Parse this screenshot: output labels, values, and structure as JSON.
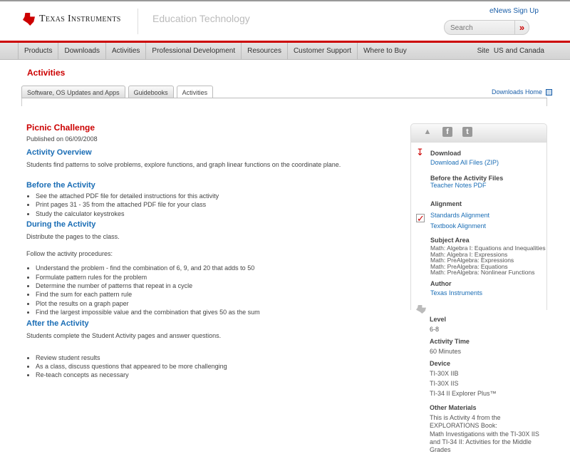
{
  "header": {
    "brand": "Texas Instruments",
    "section": "Education Technology",
    "enews": "eNews Sign Up",
    "search_placeholder": "Search",
    "search_go": "»"
  },
  "nav": {
    "items": [
      "Products",
      "Downloads",
      "Activities",
      "Professional Development",
      "Resources",
      "Customer Support",
      "Where to Buy"
    ],
    "site_label": "Site",
    "site_value": "US and Canada"
  },
  "page": {
    "heading": "Activities",
    "tabs": [
      "Software, OS Updates and Apps",
      "Guidebooks",
      "Activities"
    ],
    "downloads_home": "Downloads Home"
  },
  "main": {
    "title": "Picnic Challenge",
    "published": "Published on 06/09/2008",
    "overview_h": "Activity Overview",
    "overview": "Students find patterns to solve problems, explore functions, and graph linear functions on the coordinate plane.",
    "before_h": "Before the Activity",
    "before_items": [
      "See the attached PDF file for detailed instructions for this activity",
      "Print pages 31 - 35 from the attached PDF file for your class",
      "Study the calculator keystrokes"
    ],
    "during_h": "During the Activity",
    "during_p1": "Distribute the pages to the class.",
    "during_p2": "Follow the activity procedures:",
    "during_items": [
      "Understand the problem - find the combination of 6, 9, and 20 that adds to 50",
      "Formulate pattern rules for the problem",
      "Determine the number of patterns that repeat in a cycle",
      "Find the sum for each pattern rule",
      "Plot the results on a graph paper",
      "Find the largest impossible value and the combination that gives 50 as the sum"
    ],
    "after_h": "After the Activity",
    "after_p": "Students complete the Student Activity pages and answer questions.",
    "after_items": [
      "Review student results",
      "As a class, discuss questions that appeared to be more challenging",
      "Re-teach concepts as necessary"
    ]
  },
  "sidebar": {
    "download_h": "Download",
    "download_all": "Download All Files (ZIP)",
    "before_files_h": "Before the Activity Files",
    "teacher_notes": "Teacher Notes PDF",
    "alignment_h": "Alignment",
    "standards": "Standards Alignment",
    "textbook": "Textbook Alignment",
    "subject_h": "Subject Area",
    "subjects": [
      "Math: Algebra I: Equations and Inequalities",
      "Math: Algebra I: Expressions",
      "Math: PreAlgebra: Expressions",
      "Math: PreAlgebra: Equations",
      "Math: PreAlgebra: Nonlinear Functions"
    ],
    "author_h": "Author",
    "author": "Texas Instruments",
    "level_h": "Level",
    "level": "6-8",
    "time_h": "Activity Time",
    "time": "60 Minutes",
    "device_h": "Device",
    "devices": [
      "TI-30X IIB",
      "TI-30X IIS",
      "TI-34 II Explorer Plus™"
    ],
    "other_h": "Other Materials",
    "other_lines": [
      "This is Activity 4 from the EXPLORATIONS Book:",
      "Math Investigations with the TI-30X IIS and TI-34 II: Activities for the Middle Grades"
    ]
  }
}
